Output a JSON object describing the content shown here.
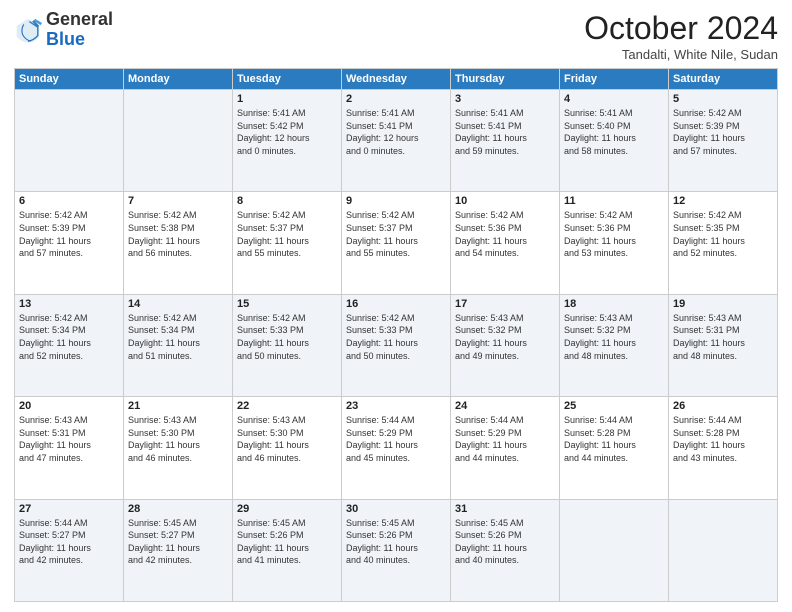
{
  "header": {
    "logo_general": "General",
    "logo_blue": "Blue",
    "month_title": "October 2024",
    "location": "Tandalti, White Nile, Sudan"
  },
  "days_of_week": [
    "Sunday",
    "Monday",
    "Tuesday",
    "Wednesday",
    "Thursday",
    "Friday",
    "Saturday"
  ],
  "weeks": [
    [
      {
        "day": "",
        "info": ""
      },
      {
        "day": "",
        "info": ""
      },
      {
        "day": "1",
        "info": "Sunrise: 5:41 AM\nSunset: 5:42 PM\nDaylight: 12 hours\nand 0 minutes."
      },
      {
        "day": "2",
        "info": "Sunrise: 5:41 AM\nSunset: 5:41 PM\nDaylight: 12 hours\nand 0 minutes."
      },
      {
        "day": "3",
        "info": "Sunrise: 5:41 AM\nSunset: 5:41 PM\nDaylight: 11 hours\nand 59 minutes."
      },
      {
        "day": "4",
        "info": "Sunrise: 5:41 AM\nSunset: 5:40 PM\nDaylight: 11 hours\nand 58 minutes."
      },
      {
        "day": "5",
        "info": "Sunrise: 5:42 AM\nSunset: 5:39 PM\nDaylight: 11 hours\nand 57 minutes."
      }
    ],
    [
      {
        "day": "6",
        "info": "Sunrise: 5:42 AM\nSunset: 5:39 PM\nDaylight: 11 hours\nand 57 minutes."
      },
      {
        "day": "7",
        "info": "Sunrise: 5:42 AM\nSunset: 5:38 PM\nDaylight: 11 hours\nand 56 minutes."
      },
      {
        "day": "8",
        "info": "Sunrise: 5:42 AM\nSunset: 5:37 PM\nDaylight: 11 hours\nand 55 minutes."
      },
      {
        "day": "9",
        "info": "Sunrise: 5:42 AM\nSunset: 5:37 PM\nDaylight: 11 hours\nand 55 minutes."
      },
      {
        "day": "10",
        "info": "Sunrise: 5:42 AM\nSunset: 5:36 PM\nDaylight: 11 hours\nand 54 minutes."
      },
      {
        "day": "11",
        "info": "Sunrise: 5:42 AM\nSunset: 5:36 PM\nDaylight: 11 hours\nand 53 minutes."
      },
      {
        "day": "12",
        "info": "Sunrise: 5:42 AM\nSunset: 5:35 PM\nDaylight: 11 hours\nand 52 minutes."
      }
    ],
    [
      {
        "day": "13",
        "info": "Sunrise: 5:42 AM\nSunset: 5:34 PM\nDaylight: 11 hours\nand 52 minutes."
      },
      {
        "day": "14",
        "info": "Sunrise: 5:42 AM\nSunset: 5:34 PM\nDaylight: 11 hours\nand 51 minutes."
      },
      {
        "day": "15",
        "info": "Sunrise: 5:42 AM\nSunset: 5:33 PM\nDaylight: 11 hours\nand 50 minutes."
      },
      {
        "day": "16",
        "info": "Sunrise: 5:42 AM\nSunset: 5:33 PM\nDaylight: 11 hours\nand 50 minutes."
      },
      {
        "day": "17",
        "info": "Sunrise: 5:43 AM\nSunset: 5:32 PM\nDaylight: 11 hours\nand 49 minutes."
      },
      {
        "day": "18",
        "info": "Sunrise: 5:43 AM\nSunset: 5:32 PM\nDaylight: 11 hours\nand 48 minutes."
      },
      {
        "day": "19",
        "info": "Sunrise: 5:43 AM\nSunset: 5:31 PM\nDaylight: 11 hours\nand 48 minutes."
      }
    ],
    [
      {
        "day": "20",
        "info": "Sunrise: 5:43 AM\nSunset: 5:31 PM\nDaylight: 11 hours\nand 47 minutes."
      },
      {
        "day": "21",
        "info": "Sunrise: 5:43 AM\nSunset: 5:30 PM\nDaylight: 11 hours\nand 46 minutes."
      },
      {
        "day": "22",
        "info": "Sunrise: 5:43 AM\nSunset: 5:30 PM\nDaylight: 11 hours\nand 46 minutes."
      },
      {
        "day": "23",
        "info": "Sunrise: 5:44 AM\nSunset: 5:29 PM\nDaylight: 11 hours\nand 45 minutes."
      },
      {
        "day": "24",
        "info": "Sunrise: 5:44 AM\nSunset: 5:29 PM\nDaylight: 11 hours\nand 44 minutes."
      },
      {
        "day": "25",
        "info": "Sunrise: 5:44 AM\nSunset: 5:28 PM\nDaylight: 11 hours\nand 44 minutes."
      },
      {
        "day": "26",
        "info": "Sunrise: 5:44 AM\nSunset: 5:28 PM\nDaylight: 11 hours\nand 43 minutes."
      }
    ],
    [
      {
        "day": "27",
        "info": "Sunrise: 5:44 AM\nSunset: 5:27 PM\nDaylight: 11 hours\nand 42 minutes."
      },
      {
        "day": "28",
        "info": "Sunrise: 5:45 AM\nSunset: 5:27 PM\nDaylight: 11 hours\nand 42 minutes."
      },
      {
        "day": "29",
        "info": "Sunrise: 5:45 AM\nSunset: 5:26 PM\nDaylight: 11 hours\nand 41 minutes."
      },
      {
        "day": "30",
        "info": "Sunrise: 5:45 AM\nSunset: 5:26 PM\nDaylight: 11 hours\nand 40 minutes."
      },
      {
        "day": "31",
        "info": "Sunrise: 5:45 AM\nSunset: 5:26 PM\nDaylight: 11 hours\nand 40 minutes."
      },
      {
        "day": "",
        "info": ""
      },
      {
        "day": "",
        "info": ""
      }
    ]
  ]
}
